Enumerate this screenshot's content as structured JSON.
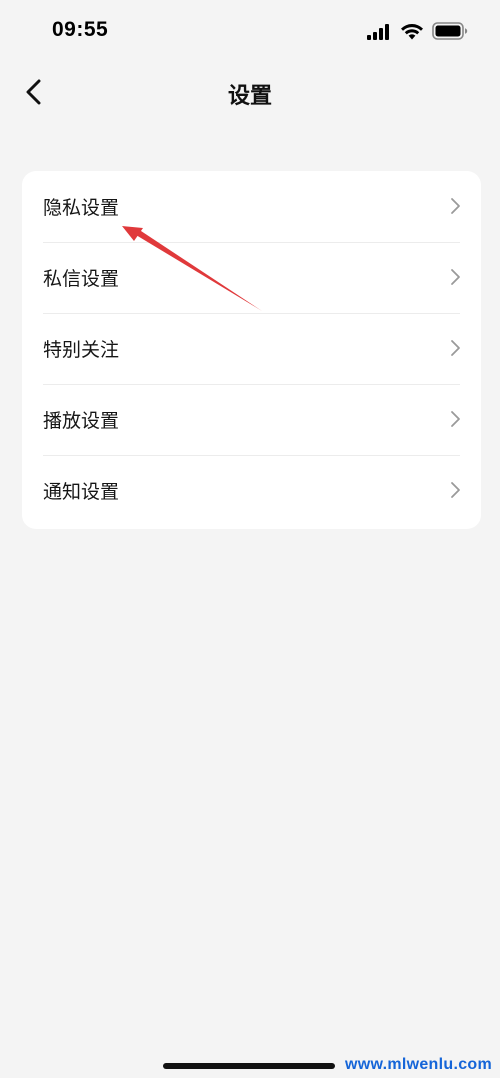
{
  "status_bar": {
    "time": "09:55",
    "signal_icon": "signal-bars-icon",
    "wifi_icon": "wifi-icon",
    "battery_icon": "battery-icon"
  },
  "nav": {
    "back_icon": "chevron-left-icon",
    "title": "设置"
  },
  "settings_list": {
    "items": [
      {
        "label": "隐私设置",
        "icon": "chevron-right-icon"
      },
      {
        "label": "私信设置",
        "icon": "chevron-right-icon"
      },
      {
        "label": "特别关注",
        "icon": "chevron-right-icon"
      },
      {
        "label": "播放设置",
        "icon": "chevron-right-icon"
      },
      {
        "label": "通知设置",
        "icon": "chevron-right-icon"
      }
    ]
  },
  "annotation": {
    "arrow_color": "#e0393b"
  },
  "watermark": "www.mlwenlu.com",
  "colors": {
    "background": "#f4f4f4",
    "card": "#ffffff",
    "text": "#111111",
    "chevron": "#9a9a9a",
    "watermark": "#1565d8"
  }
}
